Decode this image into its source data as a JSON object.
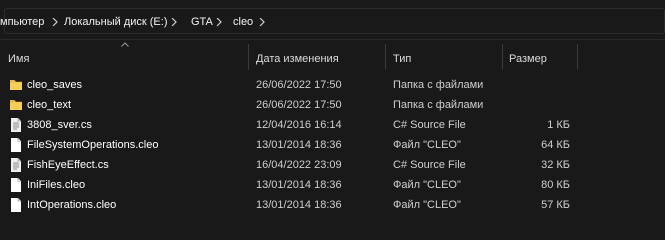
{
  "breadcrumb": {
    "items": [
      "мпьютер",
      "Локальный диск (E:)",
      "GTA",
      "cleo"
    ]
  },
  "columns": {
    "name": "Имя",
    "date": "Дата изменения",
    "type": "Тип",
    "size": "Размер"
  },
  "files": [
    {
      "name": "cleo_saves",
      "date": "26/06/2022 17:50",
      "type": "Папка с файлами",
      "size": "",
      "icon": "folder-icon"
    },
    {
      "name": "cleo_text",
      "date": "26/06/2022 17:50",
      "type": "Папка с файлами",
      "size": "",
      "icon": "folder-icon"
    },
    {
      "name": "3808_sver.cs",
      "date": "12/04/2016 16:14",
      "type": "C# Source File",
      "size": "1 КБ",
      "icon": "cs-file-icon"
    },
    {
      "name": "FileSystemOperations.cleo",
      "date": "13/01/2014 18:36",
      "type": "Файл \"CLEO\"",
      "size": "64 КБ",
      "icon": "file-icon"
    },
    {
      "name": "FishEyeEffect.cs",
      "date": "16/04/2022 23:09",
      "type": "C# Source File",
      "size": "32 КБ",
      "icon": "cs-file-icon"
    },
    {
      "name": "IniFiles.cleo",
      "date": "13/01/2014 18:36",
      "type": "Файл \"CLEO\"",
      "size": "80 КБ",
      "icon": "file-icon"
    },
    {
      "name": "IntOperations.cleo",
      "date": "13/01/2014 18:36",
      "type": "Файл \"CLEO\"",
      "size": "57 КБ",
      "icon": "file-icon"
    }
  ],
  "colors": {
    "background": "#191919",
    "folder": "#f2c94c",
    "text": "#ffffff",
    "muted": "#cfcfcf"
  }
}
